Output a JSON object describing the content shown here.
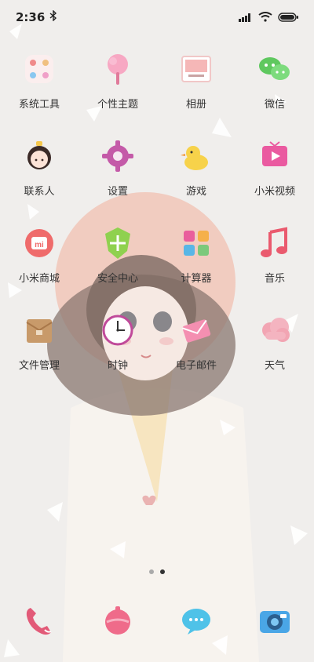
{
  "status_bar": {
    "time": "2:36",
    "icons": [
      "bluetooth-icon",
      "signal-icon",
      "wifi-icon",
      "battery-icon"
    ]
  },
  "apps": [
    {
      "label": "系统工具",
      "icon": "tools-folder-icon"
    },
    {
      "label": "个性主题",
      "icon": "cotton-candy-theme-icon"
    },
    {
      "label": "相册",
      "icon": "photo-card-icon"
    },
    {
      "label": "微信",
      "icon": "wechat-bubbles-icon"
    },
    {
      "label": "联系人",
      "icon": "girl-contacts-icon"
    },
    {
      "label": "设置",
      "icon": "gear-settings-icon"
    },
    {
      "label": "游戏",
      "icon": "duck-game-icon"
    },
    {
      "label": "小米视频",
      "icon": "tv-play-icon"
    },
    {
      "label": "小米商城",
      "icon": "mi-store-icon"
    },
    {
      "label": "安全中心",
      "icon": "shield-security-icon"
    },
    {
      "label": "计算器",
      "icon": "calculator-icon"
    },
    {
      "label": "音乐",
      "icon": "music-note-icon"
    },
    {
      "label": "文件管理",
      "icon": "file-box-icon"
    },
    {
      "label": "时钟",
      "icon": "clock-icon"
    },
    {
      "label": "电子邮件",
      "icon": "envelope-mail-icon"
    },
    {
      "label": "天气",
      "icon": "cloud-weather-icon"
    }
  ],
  "pager": {
    "pages": 2,
    "active_index": 1
  },
  "dock": [
    {
      "icon": "phone-handset-icon"
    },
    {
      "icon": "message-ball-icon"
    },
    {
      "icon": "chat-bubble-icon"
    },
    {
      "icon": "camera-icon"
    }
  ]
}
